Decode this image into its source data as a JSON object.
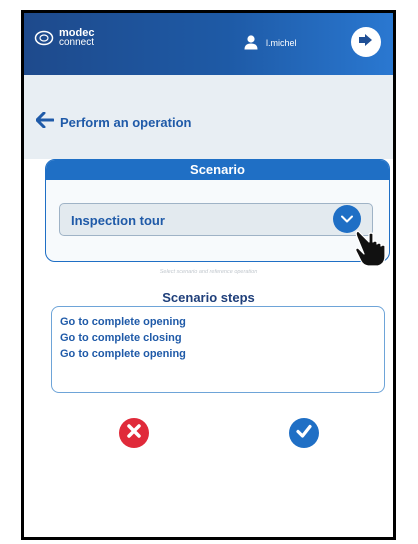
{
  "header": {
    "logo_line1": "modec",
    "logo_line2": "connect",
    "username": "l.michel"
  },
  "navigation": {
    "back_label": "Perform an operation"
  },
  "scenario": {
    "title": "Scenario",
    "selected": "Inspection tour",
    "hint": "Select scenario and reference operation"
  },
  "steps": {
    "title": "Scenario steps",
    "items": [
      "Go to complete opening",
      "Go to complete closing",
      "Go to complete opening"
    ]
  },
  "icons": {
    "logo": "modec-logo-icon",
    "user": "user-icon",
    "logout": "logout-icon",
    "back": "arrow-left-icon",
    "dropdown": "chevron-down-icon",
    "pointer": "hand-pointer-icon",
    "cancel": "cancel-x-icon",
    "confirm": "checkmark-icon"
  },
  "colors": {
    "header_blue": "#1e4a8c",
    "accent_blue": "#1f6fc5",
    "cancel_red": "#e02a3a"
  }
}
